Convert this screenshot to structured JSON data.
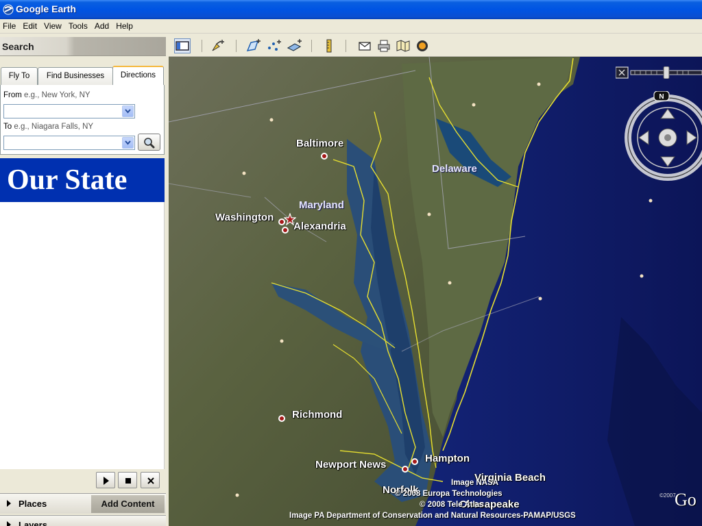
{
  "window": {
    "title": "Google Earth"
  },
  "menu": [
    "File",
    "Edit",
    "View",
    "Tools",
    "Add",
    "Help"
  ],
  "search": {
    "title": "Search",
    "tabs": [
      "Fly To",
      "Find Businesses",
      "Directions"
    ],
    "active_tab": "Directions",
    "from_label": "From",
    "from_hint": "e.g., New York, NY",
    "from_value": "",
    "to_label": "To",
    "to_hint": "e.g., Niagara Falls, NY",
    "to_value": ""
  },
  "overlay_title": "Our State",
  "places": {
    "label": "Places",
    "add_content": "Add Content"
  },
  "layers": {
    "label": "Layers"
  },
  "map": {
    "cities": [
      "Baltimore",
      "Washington",
      "Alexandria",
      "Richmond",
      "Newport News",
      "Hampton",
      "Norfolk",
      "Virginia Beach",
      "Chesapeake"
    ],
    "states": [
      "Delaware",
      "Maryland"
    ],
    "credits": [
      "Image NASA",
      "© 2008 Europa Technologies",
      "© 2008 Tele Atlas",
      "Image PA Department of Conservation and Natural Resources-PAMAP/USGS"
    ],
    "logo_text": "Go",
    "logo_year": "©2007",
    "compass_label": "N"
  },
  "colors": {
    "titlebar": "#0054e3",
    "overlay_bg": "#0030b0",
    "coast": "#e8e030",
    "ocean": "#0d1a5a"
  }
}
